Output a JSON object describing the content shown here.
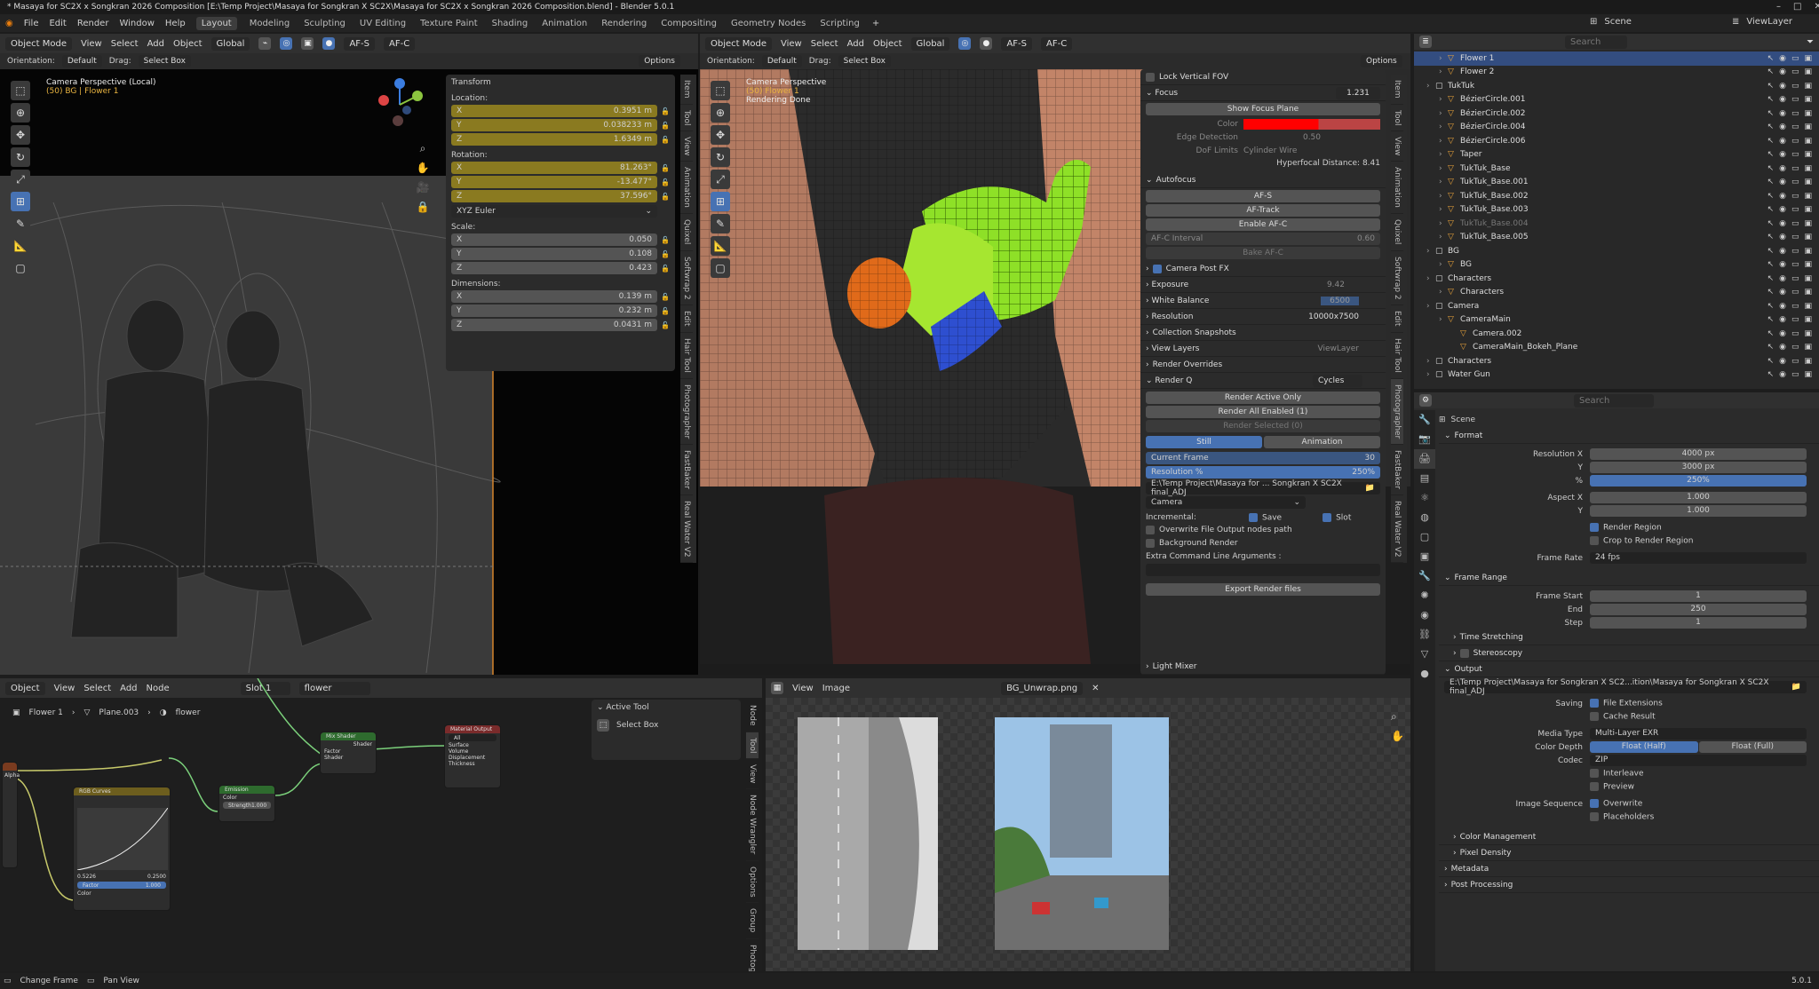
{
  "title": "* Masaya for SC2X x Songkran 2026 Composition [E:\\Temp Project\\Masaya for Songkran X SC2X\\Masaya for SC2X x Songkran 2026 Composition.blend] - Blender 5.0.1",
  "menu": [
    "File",
    "Edit",
    "Render",
    "Window",
    "Help"
  ],
  "workspaces": [
    "Layout",
    "Modeling",
    "Sculpting",
    "UV Editing",
    "Texture Paint",
    "Shading",
    "Animation",
    "Rendering",
    "Compositing",
    "Geometry Nodes",
    "Scripting"
  ],
  "scene_label": "Scene",
  "view_layer_label": "ViewLayer",
  "vp_header": {
    "mode": "Object Mode",
    "items": [
      "View",
      "Select",
      "Add",
      "Object"
    ],
    "orient": "Global",
    "afs": "AF-S",
    "afc": "AF-C"
  },
  "vp_sub": {
    "orientation": "Orientation:",
    "orientation_val": "Default",
    "drag": "Drag:",
    "drag_val": "Select Box",
    "options": "Options"
  },
  "vp1": {
    "line1": "Camera Perspective (Local)",
    "line2": "(50) BG | Flower 1"
  },
  "vp2": {
    "line1": "Camera Perspective",
    "line2": "(50) Flower 1",
    "line3": "Rendering Done"
  },
  "transform": {
    "title": "Transform",
    "location": "Location:",
    "loc": [
      "0.3951 m",
      "0.038233 m",
      "1.6349 m"
    ],
    "rotation": "Rotation:",
    "rot": [
      "81.263°",
      "-13.477°",
      "37.596°"
    ],
    "euler": "XYZ Euler",
    "scale_l": "Scale:",
    "scale": [
      "0.050",
      "0.108",
      "0.423"
    ],
    "dimensions": "Dimensions:",
    "dims": [
      "0.139 m",
      "0.232 m",
      "0.0431 m"
    ],
    "axes": [
      "X",
      "Y",
      "Z"
    ]
  },
  "vtabs1": [
    "Item",
    "Tool",
    "View",
    "Animation",
    "Quixel",
    "Softwrap 2",
    "Edit",
    "Hair Tool",
    "Photographer",
    "FastBaker",
    "Real Water V2"
  ],
  "photog": {
    "lock": "Lock Vertical FOV",
    "focus": "Focus",
    "focus_val": "1.231",
    "show_plane": "Show Focus Plane",
    "color": "Color",
    "edge": "Edge Detection",
    "edge_val": "0.50",
    "dof": "DoF Limits",
    "dof_val": "Cylinder Wire",
    "hyper": "Hyperfocal Distance: 8.41",
    "autofocus": "Autofocus",
    "afs": "AF-S",
    "aftrack": "AF-Track",
    "enable_afc": "Enable AF-C",
    "afc_int": "AF-C Interval",
    "afc_val": "0.60",
    "bake": "Bake AF-C",
    "post": "Camera Post FX",
    "exposure": "Exposure",
    "exposure_val": "9.42",
    "wb": "White Balance",
    "wb_val": "6500",
    "res": "Resolution",
    "res_val": "10000x7500",
    "snap": "Collection Snapshots",
    "vl": "View Layers",
    "vl_val": "ViewLayer",
    "ro": "Render Overrides",
    "rq": "Render Q",
    "engine": "Cycles",
    "active_only": "Render Active Only",
    "all_enabled": "Render All Enabled (1)",
    "selected": "Render Selected (0)",
    "still": "Still",
    "anim": "Animation",
    "cur": "Current Frame",
    "cur_val": "30",
    "resp": "Resolution %",
    "resp_val": "250%",
    "path": "E:\\Temp Project\\Masaya for ... Songkran X SC2X final_ADJ",
    "cam": "Camera",
    "incr": "Incremental:",
    "save": "Save",
    "slot": "Slot",
    "overwrite": "Overwrite File Output nodes path",
    "bg": "Background Render",
    "extra": "Extra Command Line Arguments :",
    "export": "Export Render files",
    "light": "Light Mixer"
  },
  "node_header": {
    "mode": "Object",
    "items": [
      "View",
      "Select",
      "Add",
      "Node"
    ],
    "slot": "Slot 1",
    "mat": "flower"
  },
  "node_bc": [
    "Flower 1",
    "Plane.003",
    "flower"
  ],
  "nodes": {
    "rgb": "RGB Curves",
    "emission": "Emission",
    "mix": "Mix Shader",
    "out": "Material Output",
    "strength": "Strength",
    "strength_val": "1.000",
    "factor": "Factor",
    "factor_val": "1.000",
    "shader": "Shader",
    "color": "Color",
    "all": "All",
    "surface": "Surface",
    "volume": "Volume",
    "displacement": "Displacement",
    "thickness": "Thickness",
    "alpha": "Alpha",
    "curve_x": "0.5226",
    "curve_y": "0.2500"
  },
  "active_tool": {
    "title": "Active Tool",
    "tool": "Select Box"
  },
  "vtabs2": [
    "Node",
    "Tool",
    "View",
    "Node Wrangler",
    "Options",
    "Group",
    "Photographer"
  ],
  "img_header": {
    "items": [
      "View",
      "Image"
    ],
    "name": "BG_Unwrap.png"
  },
  "outliner": {
    "search": "Search",
    "rows": [
      {
        "t": "Flower 1",
        "d": 1,
        "sel": true
      },
      {
        "t": "Flower 2",
        "d": 1
      },
      {
        "t": "TukTuk",
        "d": 0
      },
      {
        "t": "BézierCircle.001",
        "d": 1
      },
      {
        "t": "BézierCircle.002",
        "d": 1
      },
      {
        "t": "BézierCircle.004",
        "d": 1
      },
      {
        "t": "BézierCircle.006",
        "d": 1
      },
      {
        "t": "Taper",
        "d": 1
      },
      {
        "t": "TukTuk_Base",
        "d": 1
      },
      {
        "t": "TukTuk_Base.001",
        "d": 1
      },
      {
        "t": "TukTuk_Base.002",
        "d": 1
      },
      {
        "t": "TukTuk_Base.003",
        "d": 1
      },
      {
        "t": "TukTuk_Base.004",
        "d": 1,
        "dim": true
      },
      {
        "t": "TukTuk_Base.005",
        "d": 1
      },
      {
        "t": "BG",
        "d": 0
      },
      {
        "t": "BG",
        "d": 1
      },
      {
        "t": "Characters",
        "d": 0
      },
      {
        "t": "Characters",
        "d": 1
      },
      {
        "t": "Camera",
        "d": 0
      },
      {
        "t": "CameraMain",
        "d": 1
      },
      {
        "t": "Camera.002",
        "d": 2
      },
      {
        "t": "CameraMain_Bokeh_Plane",
        "d": 2
      },
      {
        "t": "Characters",
        "d": 0
      },
      {
        "t": "Water Gun",
        "d": 0
      }
    ]
  },
  "props": {
    "search": "Search",
    "scene": "Scene",
    "format": "Format",
    "resx": "Resolution X",
    "resx_val": "4000 px",
    "y": "Y",
    "resy_val": "3000 px",
    "pct": "%",
    "pct_val": "250%",
    "aspx": "Aspect X",
    "aspx_val": "1.000",
    "aspy_val": "1.000",
    "region": "Render Region",
    "crop": "Crop to Render Region",
    "fr": "Frame Rate",
    "fr_val": "24 fps",
    "frange": "Frame Range",
    "fstart": "Frame Start",
    "fstart_val": "1",
    "end": "End",
    "end_val": "250",
    "step": "Step",
    "step_val": "1",
    "ts": "Time Stretching",
    "stereo": "Stereoscopy",
    "output": "Output",
    "out_path": "E:\\Temp Project\\Masaya for Songkran X SC2...ition\\Masaya for Songkran X SC2X final_ADJ",
    "saving": "Saving",
    "fe": "File Extensions",
    "cache": "Cache Result",
    "media": "Media Type",
    "media_val": "Multi-Layer EXR",
    "depth": "Color Depth",
    "half": "Float (Half)",
    "full": "Float (Full)",
    "codec": "Codec",
    "codec_val": "ZIP",
    "inter": "Interleave",
    "prev": "Preview",
    "seq": "Image Sequence",
    "ow": "Overwrite",
    "ph": "Placeholders",
    "cm": "Color Management",
    "pd": "Pixel Density",
    "meta": "Metadata",
    "pp": "Post Processing"
  },
  "status": {
    "left1": "Change Frame",
    "left2": "Pan View",
    "version": "5.0.1"
  }
}
